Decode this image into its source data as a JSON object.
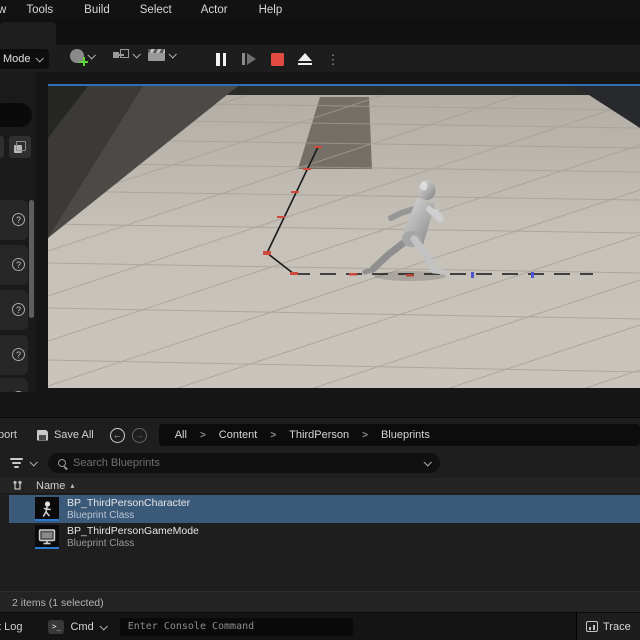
{
  "menu_bar": {
    "clipped_item": "w",
    "items": [
      "Tools",
      "Build",
      "Select",
      "Actor",
      "Help"
    ]
  },
  "toolbar": {
    "mode_label": "Mode",
    "icon_buttons": [
      "add-actor",
      "blueprints",
      "cinematics"
    ],
    "play_controls": [
      "pause",
      "step-frame",
      "stop",
      "eject",
      "options"
    ]
  },
  "left_panel": {
    "card_count": 5
  },
  "content_browser": {
    "import_clipped": "port",
    "save_all_label": "Save All",
    "breadcrumb": [
      "All",
      "Content",
      "ThirdPerson",
      "Blueprints"
    ],
    "search_placeholder": "Search Blueprints",
    "name_column": "Name",
    "items": [
      {
        "title": "BP_ThirdPersonCharacter",
        "subtitle": "Blueprint Class",
        "selected": true
      },
      {
        "title": "BP_ThirdPersonGameMode",
        "subtitle": "Blueprint Class",
        "selected": false
      }
    ],
    "status_text": "2 items (1 selected)"
  },
  "status_bar": {
    "log_clipped": "t Log",
    "cmd_label": "Cmd",
    "cmd_icon_glyph": ">_",
    "console_placeholder": "Enter Console Command",
    "trace_label": "Trace"
  },
  "icons": {
    "dots_vertical": "⋮",
    "back_arrow": "←",
    "forward_arrow": "→",
    "sort_asc": "▴",
    "help": "?"
  },
  "colors": {
    "selection_blue": "#3b5a7a",
    "blueprint_accent": "#2f7ad1",
    "stop_red": "#e14b42",
    "viewport_selected_border": "#2e6fb5",
    "play_trajectory_red": "#cf4a3c",
    "play_trajectory_blue": "#4a55d0"
  }
}
